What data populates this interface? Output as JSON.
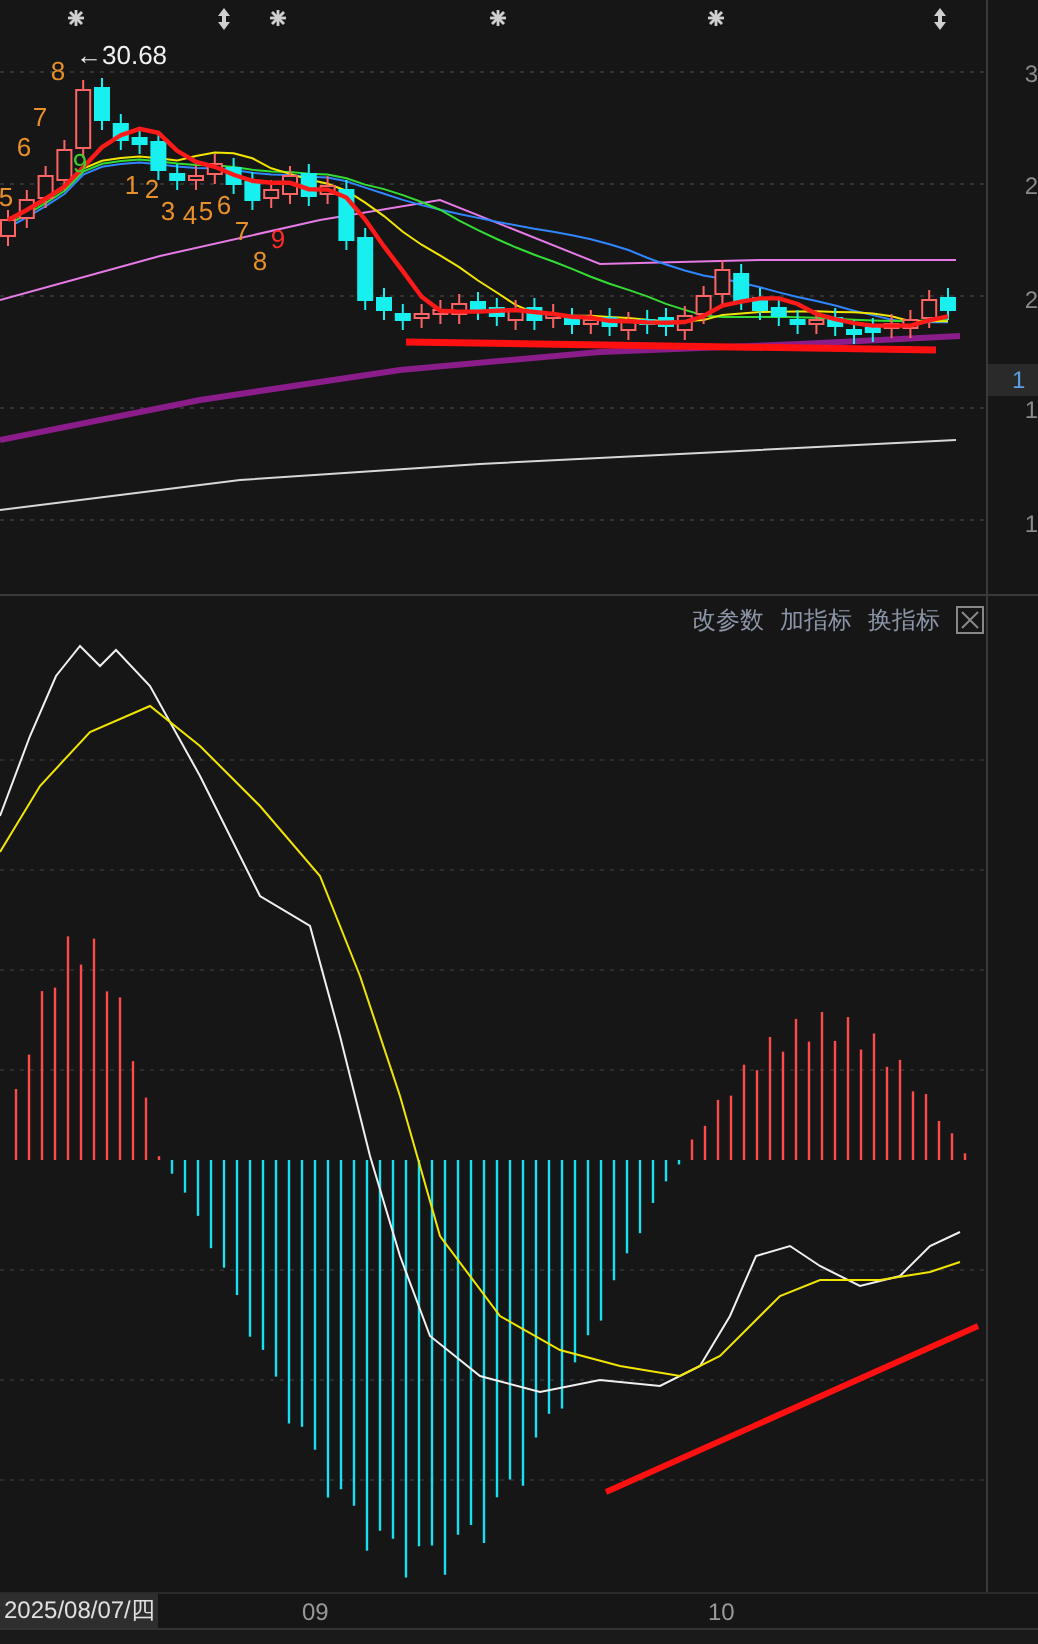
{
  "price_chart": {
    "price_label": "←30.68",
    "sequence_labels": [
      {
        "text": "5",
        "color": "#e8902a"
      },
      {
        "text": "6",
        "color": "#e8902a"
      },
      {
        "text": "7",
        "color": "#e8902a"
      },
      {
        "text": "8",
        "color": "#e8902a"
      },
      {
        "text": "9",
        "color": "#3ccf2a"
      },
      {
        "text": "1",
        "color": "#e8902a"
      },
      {
        "text": "2",
        "color": "#e8902a"
      },
      {
        "text": "3",
        "color": "#e8902a"
      },
      {
        "text": "4",
        "color": "#e8902a"
      },
      {
        "text": "5",
        "color": "#e8902a"
      },
      {
        "text": "6",
        "color": "#e8902a"
      },
      {
        "text": "7",
        "color": "#e8902a"
      },
      {
        "text": "8",
        "color": "#e8902a"
      },
      {
        "text": "9",
        "color": "#ff2a2a"
      }
    ],
    "axis_labels": [
      {
        "text": "3",
        "selected": false
      },
      {
        "text": "2",
        "selected": false
      },
      {
        "text": "2",
        "selected": false
      },
      {
        "text": "1",
        "selected": true
      },
      {
        "text": "1",
        "selected": false
      },
      {
        "text": "1",
        "selected": false
      }
    ]
  },
  "indicator_panel": {
    "toolbar": [
      "改参数",
      "加指标",
      "换指标"
    ]
  },
  "time_axis": {
    "cursor_date": "2025/08/07/四",
    "months": [
      "09",
      "10"
    ]
  }
}
